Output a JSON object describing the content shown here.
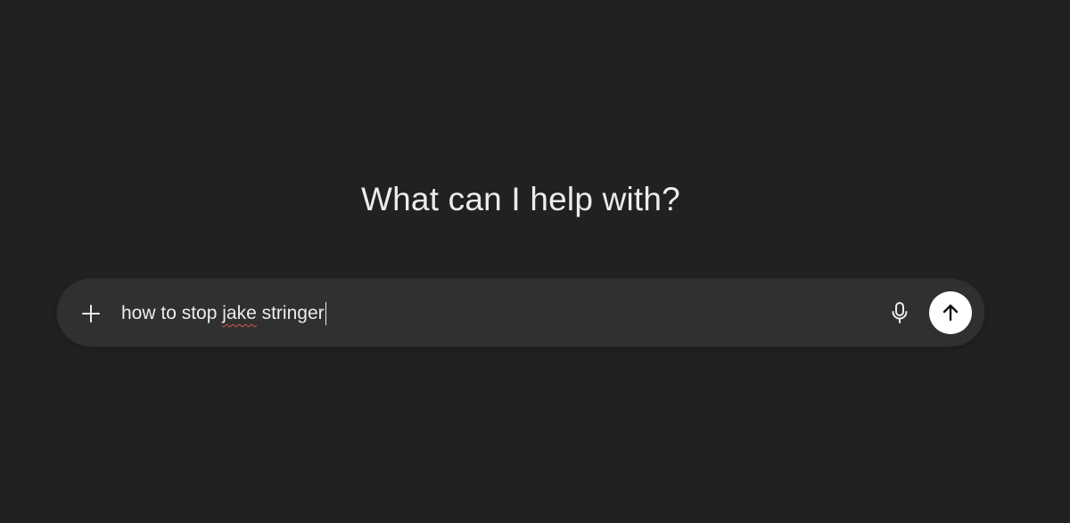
{
  "heading": "What can I help with?",
  "composer": {
    "input_text_before": "how to stop ",
    "input_text_misspelled": "jake",
    "input_text_after": " stringer",
    "plus_icon": "plus-icon",
    "mic_icon": "microphone-icon",
    "send_icon": "arrow-up-icon"
  },
  "colors": {
    "background": "#212121",
    "composer_bg": "#303030",
    "text": "#ececec",
    "send_button_bg": "#ffffff",
    "spellcheck_underline": "#d9534f"
  }
}
